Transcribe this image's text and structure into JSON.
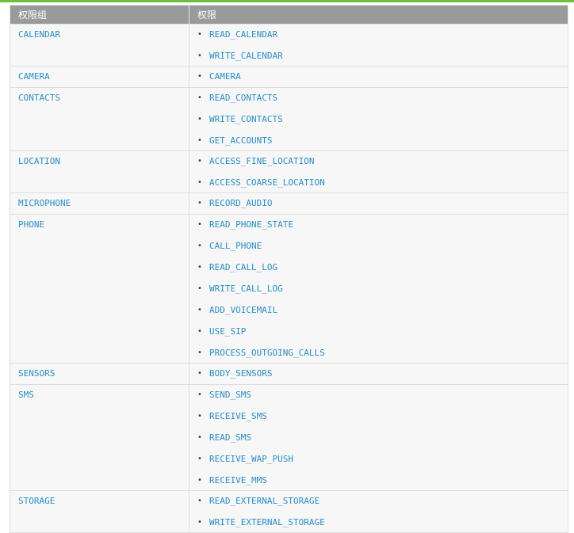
{
  "header": {
    "group_col": "权限组",
    "perm_col": "权限"
  },
  "rows": [
    {
      "group": "CALENDAR",
      "perms": [
        "READ_CALENDAR",
        "WRITE_CALENDAR"
      ]
    },
    {
      "group": "CAMERA",
      "perms": [
        "CAMERA"
      ]
    },
    {
      "group": "CONTACTS",
      "perms": [
        "READ_CONTACTS",
        "WRITE_CONTACTS",
        "GET_ACCOUNTS"
      ]
    },
    {
      "group": "LOCATION",
      "perms": [
        "ACCESS_FINE_LOCATION",
        "ACCESS_COARSE_LOCATION"
      ]
    },
    {
      "group": "MICROPHONE",
      "perms": [
        "RECORD_AUDIO"
      ]
    },
    {
      "group": "PHONE",
      "perms": [
        "READ_PHONE_STATE",
        "CALL_PHONE",
        "READ_CALL_LOG",
        "WRITE_CALL_LOG",
        "ADD_VOICEMAIL",
        "USE_SIP",
        "PROCESS_OUTGOING_CALLS"
      ]
    },
    {
      "group": "SENSORS",
      "perms": [
        "BODY_SENSORS"
      ]
    },
    {
      "group": "SMS",
      "perms": [
        "SEND_SMS",
        "RECEIVE_SMS",
        "READ_SMS",
        "RECEIVE_WAP_PUSH",
        "RECEIVE_MMS"
      ]
    },
    {
      "group": "STORAGE",
      "perms": [
        "READ_EXTERNAL_STORAGE",
        "WRITE_EXTERNAL_STORAGE"
      ]
    }
  ],
  "colors": {
    "accent_bar": "#6fbf3f",
    "header_bg": "#9a9a9a",
    "link_text": "#2a8ec7"
  }
}
